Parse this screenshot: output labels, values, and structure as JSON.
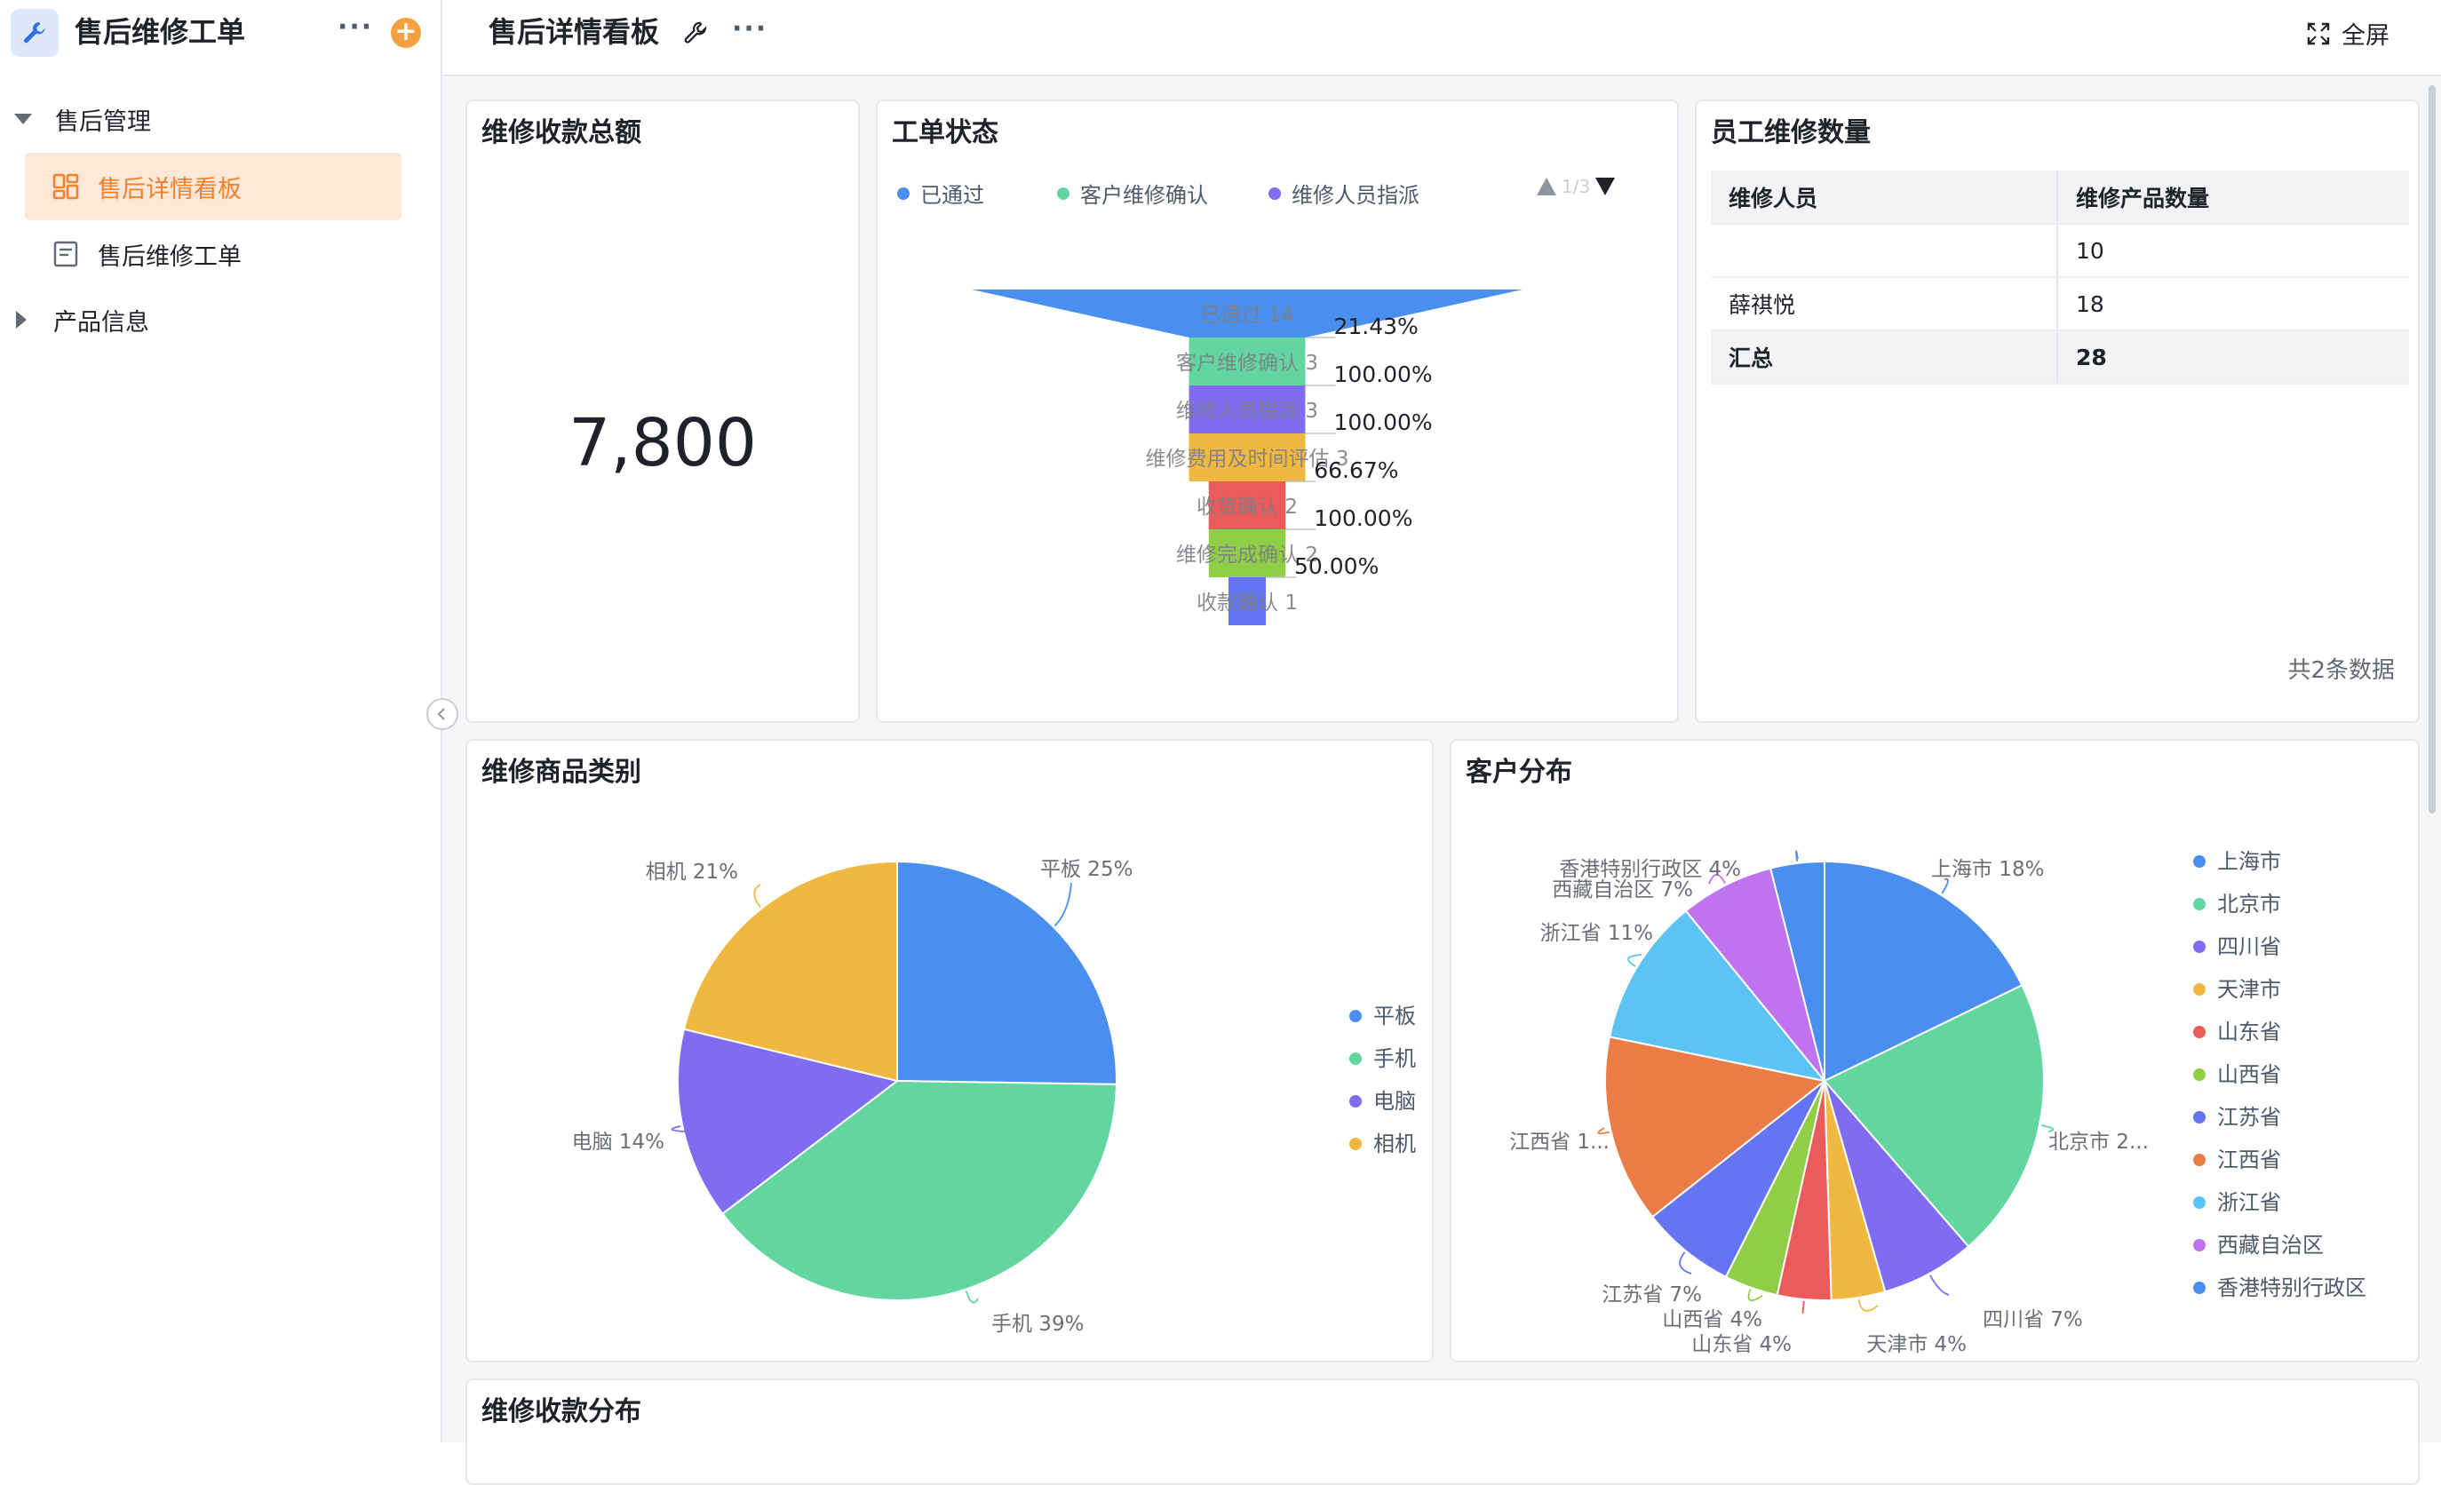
{
  "app": {
    "title": "售后维修工单",
    "more": "···",
    "add": "+"
  },
  "sidebar": {
    "groups": [
      {
        "label": "售后管理",
        "expanded": true
      },
      {
        "label": "产品信息",
        "expanded": false
      }
    ],
    "items": [
      {
        "label": "售后详情看板",
        "active": true
      },
      {
        "label": "售后维修工单",
        "active": false
      }
    ]
  },
  "page": {
    "title": "售后详情看板",
    "more": "···",
    "fullscreen": "全屏"
  },
  "cards": {
    "total": {
      "title": "维修收款总额",
      "value": "7,800"
    },
    "status": {
      "title": "工单状态",
      "pager": "1/3"
    },
    "employee": {
      "title": "员工维修数量",
      "columns": [
        "维修人员",
        "维修产品数量"
      ],
      "rows": [
        [
          "",
          "10"
        ],
        [
          "薛祺悦",
          "18"
        ]
      ],
      "total": [
        "汇总",
        "28"
      ],
      "count_text": "共2条数据"
    },
    "category": {
      "title": "维修商品类别"
    },
    "customer": {
      "title": "客户分布"
    },
    "payment": {
      "title": "维修收款分布"
    }
  },
  "colors": {
    "blue": "#4a8ff0",
    "green": "#63d5a1",
    "purple": "#7f6cf0",
    "yellow": "#f0b840",
    "red": "#ec5b5b",
    "lime": "#8fce46",
    "indigo": "#6574f0",
    "orange": "#ec7c45",
    "sky": "#5cc4f2",
    "violet": "#c073ef",
    "accent": "#f0812f"
  },
  "chart_data": [
    {
      "type": "funnel",
      "title": "工单状态",
      "legend": [
        "已通过",
        "客户维修确认",
        "维修人员指派"
      ],
      "stages": [
        {
          "label": "已通过 14",
          "value": 14,
          "color": "#4a8ff0"
        },
        {
          "label": "客户维修确认 3",
          "value": 3,
          "color": "#63d5a1"
        },
        {
          "label": "维修人员指派 3",
          "value": 3,
          "color": "#7f6cf0"
        },
        {
          "label": "维修费用及时间评估 3",
          "value": 3,
          "color": "#f0b840"
        },
        {
          "label": "收货确认 2",
          "value": 2,
          "color": "#ec5b5b"
        },
        {
          "label": "维修完成确认 2",
          "value": 2,
          "color": "#8fce46"
        },
        {
          "label": "收款确认 1",
          "value": 1,
          "color": "#6574f0"
        }
      ],
      "conversion": [
        "21.43%",
        "100.00%",
        "100.00%",
        "66.67%",
        "100.00%",
        "50.00%"
      ]
    },
    {
      "type": "pie",
      "title": "维修商品类别",
      "slices": [
        {
          "name": "平板",
          "value": 25,
          "label": "平板 25%",
          "color": "#4a8ff0"
        },
        {
          "name": "手机",
          "value": 39,
          "label": "手机 39%",
          "color": "#63d5a1"
        },
        {
          "name": "电脑",
          "value": 14,
          "label": "电脑 14%",
          "color": "#7f6cf0"
        },
        {
          "name": "相机",
          "value": 21,
          "label": "相机 21%",
          "color": "#f0b840"
        }
      ],
      "legend": "right"
    },
    {
      "type": "pie",
      "title": "客户分布",
      "slices": [
        {
          "name": "上海市",
          "value": 18,
          "label": "上海市 18%",
          "color": "#4a8ff0"
        },
        {
          "name": "北京市",
          "value": 21,
          "label": "北京市 2...",
          "color": "#63d5a1"
        },
        {
          "name": "四川省",
          "value": 7,
          "label": "四川省 7%",
          "color": "#7f6cf0"
        },
        {
          "name": "天津市",
          "value": 4,
          "label": "天津市 4%",
          "color": "#f0b840"
        },
        {
          "name": "山东省",
          "value": 4,
          "label": "山东省 4%",
          "color": "#ec5b5b"
        },
        {
          "name": "山西省",
          "value": 4,
          "label": "山西省 4%",
          "color": "#8fce46"
        },
        {
          "name": "江苏省",
          "value": 7,
          "label": "江苏省 7%",
          "color": "#6574f0"
        },
        {
          "name": "江西省",
          "value": 14,
          "label": "江西省 1...",
          "color": "#ec7c45"
        },
        {
          "name": "浙江省",
          "value": 11,
          "label": "浙江省 11%",
          "color": "#5cc4f2"
        },
        {
          "name": "西藏自治区",
          "value": 7,
          "label": "西藏自治区 7%",
          "color": "#c073ef"
        },
        {
          "name": "香港特别行政区",
          "value": 4,
          "label": "香港特别行政区 4%",
          "color": "#4a8ff0"
        }
      ],
      "legend": "right"
    }
  ]
}
